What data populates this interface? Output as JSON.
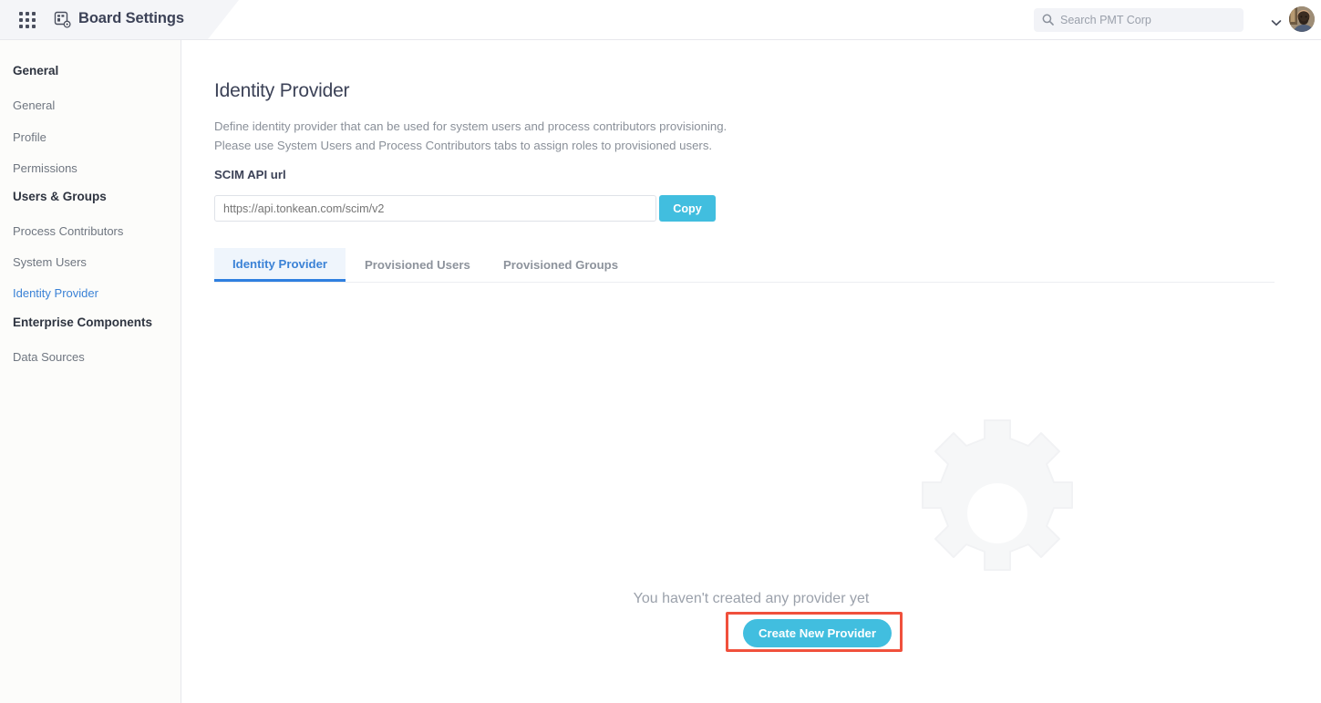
{
  "header": {
    "apps_icon": "apps-grid-icon",
    "board_icon": "board-settings-icon",
    "title": "Board Settings",
    "search": {
      "icon": "search-icon",
      "placeholder": "Search PMT Corp",
      "value": ""
    },
    "chevron_icon": "chevron-down-icon",
    "avatar": "user-avatar"
  },
  "sidebar": {
    "sections": [
      {
        "title": "General",
        "items": [
          {
            "label": "General",
            "active": false
          },
          {
            "label": "Profile",
            "active": false
          },
          {
            "label": "Permissions",
            "active": false
          }
        ]
      },
      {
        "title": "Users & Groups",
        "items": [
          {
            "label": "Process Contributors",
            "active": false
          },
          {
            "label": "System Users",
            "active": false
          },
          {
            "label": "Identity Provider",
            "active": true
          }
        ]
      },
      {
        "title": "Enterprise Components",
        "items": [
          {
            "label": "Data Sources",
            "active": false
          }
        ]
      }
    ]
  },
  "main": {
    "page_title": "Identity Provider",
    "description_line1": "Define identity provider that can be used for system users and process contributors provisioning.",
    "description_line2": "Please use System Users and Process Contributors tabs to assign roles to provisioned users.",
    "scim": {
      "label": "SCIM API url",
      "value": "https://api.tonkean.com/scim/v2",
      "placeholder": "https://api.tonkean.com/scim/v2",
      "copy_label": "Copy"
    },
    "tabs": [
      {
        "label": "Identity Provider",
        "active": true
      },
      {
        "label": "Provisioned Users",
        "active": false
      },
      {
        "label": "Provisioned Groups",
        "active": false
      }
    ],
    "empty_state": {
      "illustration": "gear-icon",
      "message": "You haven't created any provider yet",
      "cta_label": "Create New Provider"
    }
  },
  "colors": {
    "accent_cyan": "#41bedf",
    "link_blue": "#3b82d6",
    "tab_active_bg": "#eff5fc",
    "tab_underline": "#2f7fe0",
    "highlight_red": "#f0503c",
    "sidebar_bg": "#fcfcfa",
    "text_muted": "#8a9099"
  }
}
